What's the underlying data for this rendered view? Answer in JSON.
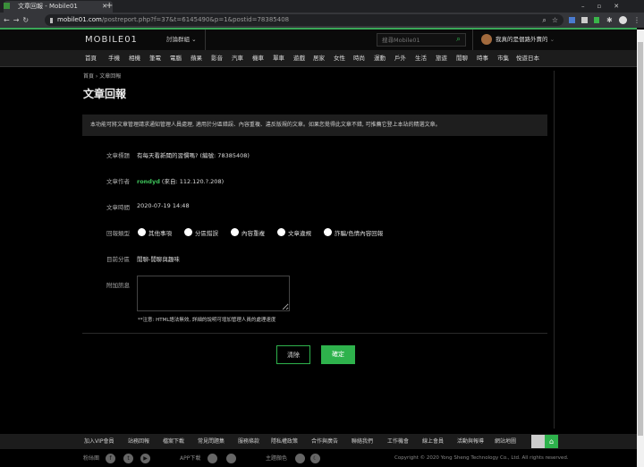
{
  "browser": {
    "tab_title": "文章回報 - Mobile01",
    "url_host": "mobile01.com",
    "url_path": "/postreport.php?f=37&t=6145490&p=1&postid=78385408",
    "new_tab": "+"
  },
  "header": {
    "logo": "MOBILE01",
    "forum_menu": "討論群組",
    "search_placeholder": "搜尋Mobile01",
    "user_name": "我真的是個路外賣的"
  },
  "nav": [
    "首頁",
    "手機",
    "相機",
    "筆電",
    "電腦",
    "蘋果",
    "影音",
    "汽車",
    "機車",
    "單車",
    "遊戲",
    "居家",
    "女性",
    "時尚",
    "運動",
    "戶外",
    "生活",
    "旅遊",
    "閒聊",
    "時事",
    "市集",
    "悅遊日本"
  ],
  "breadcrumb": [
    "首頁",
    "文章回報"
  ],
  "page_title": "文章回報",
  "notice": "本功能可將文章管理請求通知管理人員處理, 適用於分區錯誤、內容重複、違反版規的文章。如果您覺得此文章不錯, 可推薦它登上本站的精選文章。",
  "form": {
    "title_label": "文章標題",
    "title_value": "有每天看新聞的習慣嗎? (編號: 78385408)",
    "author_label": "文章作者",
    "author_name": "rondyd",
    "author_ip": "(來自: 112.120.?.208)",
    "time_label": "文章時間",
    "time_value": "2020-07-19 14:48",
    "type_label": "回報類型",
    "types": [
      "其他事項",
      "分區錯誤",
      "內容重複",
      "文章違規",
      "詐騙/色情內容回報"
    ],
    "forum_label": "目前分區",
    "forum_value": "閒聊-閒聊與趣味",
    "message_label": "附加訊息",
    "message_value": "",
    "note": "**注意: HTML語法無效, 詳細的說明可增加管理人員的處理速度",
    "clear_button": "清除",
    "submit_button": "確定"
  },
  "footer": {
    "links": [
      "加入VIP會員",
      "站務回報",
      "檔案下載",
      "常見問題集",
      "服務條款",
      "隱私權政策",
      "合作與廣告",
      "聯絡我們",
      "工作機會",
      "線上會員",
      "活動與報導",
      "網站地圖"
    ],
    "fans_label": "粉絲團",
    "app_label": "APP下載",
    "theme_label": "主題顏色",
    "copyright": "Copyright © 2020 Yong Sheng Technology Co., Ltd. All rights reserved."
  },
  "colors": {
    "accent": "#2eb24c",
    "author": "#3ec45b"
  }
}
